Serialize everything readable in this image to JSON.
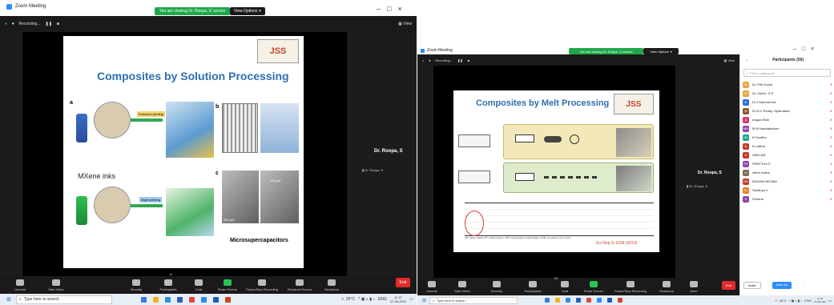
{
  "left": {
    "window_title": "Zoom Meeting",
    "banner": "You are viewing Dr. Roopa, S' screen",
    "view_options": "View Options",
    "recording": "Recording...",
    "view_label": "View",
    "speaker_name": "Dr. Roopa, S",
    "speaker_small": "Dr. Roopa, S",
    "slide": {
      "title": "Composites by Solution Processing",
      "label_a": "a",
      "label_b": "b",
      "label_c": "c",
      "extrusion": "Extrusion printing",
      "inkjet": "Inkjet printing",
      "inks": "MXene inks",
      "scale1": "200 μm",
      "scale2": "200 μm",
      "scale3": "100 μm",
      "caption": "Microsupercapacitors",
      "logo": "JSS"
    },
    "toolbar": [
      "Unmute",
      "Start Video",
      "Security",
      "Participants",
      "Chat",
      "Share Screen",
      "Pause/Stop Recording",
      "Breakout Rooms",
      "Reactions"
    ],
    "participants_count": "12",
    "end": "End",
    "taskbar": {
      "search": "Type here to search",
      "weather": "25°C",
      "lang": "ENG",
      "time": "12:37",
      "date": "27-06-2022"
    }
  },
  "right": {
    "window_title": "Zoom Meeting",
    "banner": "You are viewing Dr. Roopa, S' screen",
    "view_options": "View Options",
    "recording": "Recording...",
    "view_label": "View",
    "speaker_name": "Dr. Roopa, S",
    "speaker_small": "Dr. Roopa, S",
    "slide": {
      "title": "Composites by Melt Processing",
      "logo": "JSS",
      "citation": "Sci Rep 9, 6338 (2019)",
      "footnote": "CB: carbon black, PP: polypropylene, PET: polyethylene terephthalate, RPM: revolutions per minute"
    },
    "toolbar": [
      "Unmute",
      "Start Video",
      "Security",
      "Participants",
      "Chat",
      "Share Screen",
      "Pause/Stop Recording",
      "Reactions",
      "More"
    ],
    "participants_count": "50",
    "end": "End",
    "panel": {
      "title": "Participants (50)",
      "search_placeholder": "Find a participant",
      "names": [
        "Dr. Priti Gupta",
        "Dr. Sohini. S R",
        "Dr.J Dakruthmee",
        "Dr M V Reddy, Hyderabad",
        "Angaa Ram",
        "M M Nandakishore",
        "N Sunitha",
        "N Lalitha",
        "NEELAM",
        "PREETHA S",
        "mitha maths",
        "RIGANA BEGAM",
        "Sandhya V",
        "Shobha"
      ],
      "invite": "Invite",
      "mute_all": "Mute All"
    },
    "taskbar": {
      "search": "Type here to search",
      "weather": "26°C",
      "lang": "ENG",
      "time": "12:42",
      "date": "27-06-2022"
    }
  },
  "colors": {
    "zoom_green": "#23c552",
    "end_red": "#e02b2b",
    "slide_title_blue": "#2f6fb0"
  }
}
